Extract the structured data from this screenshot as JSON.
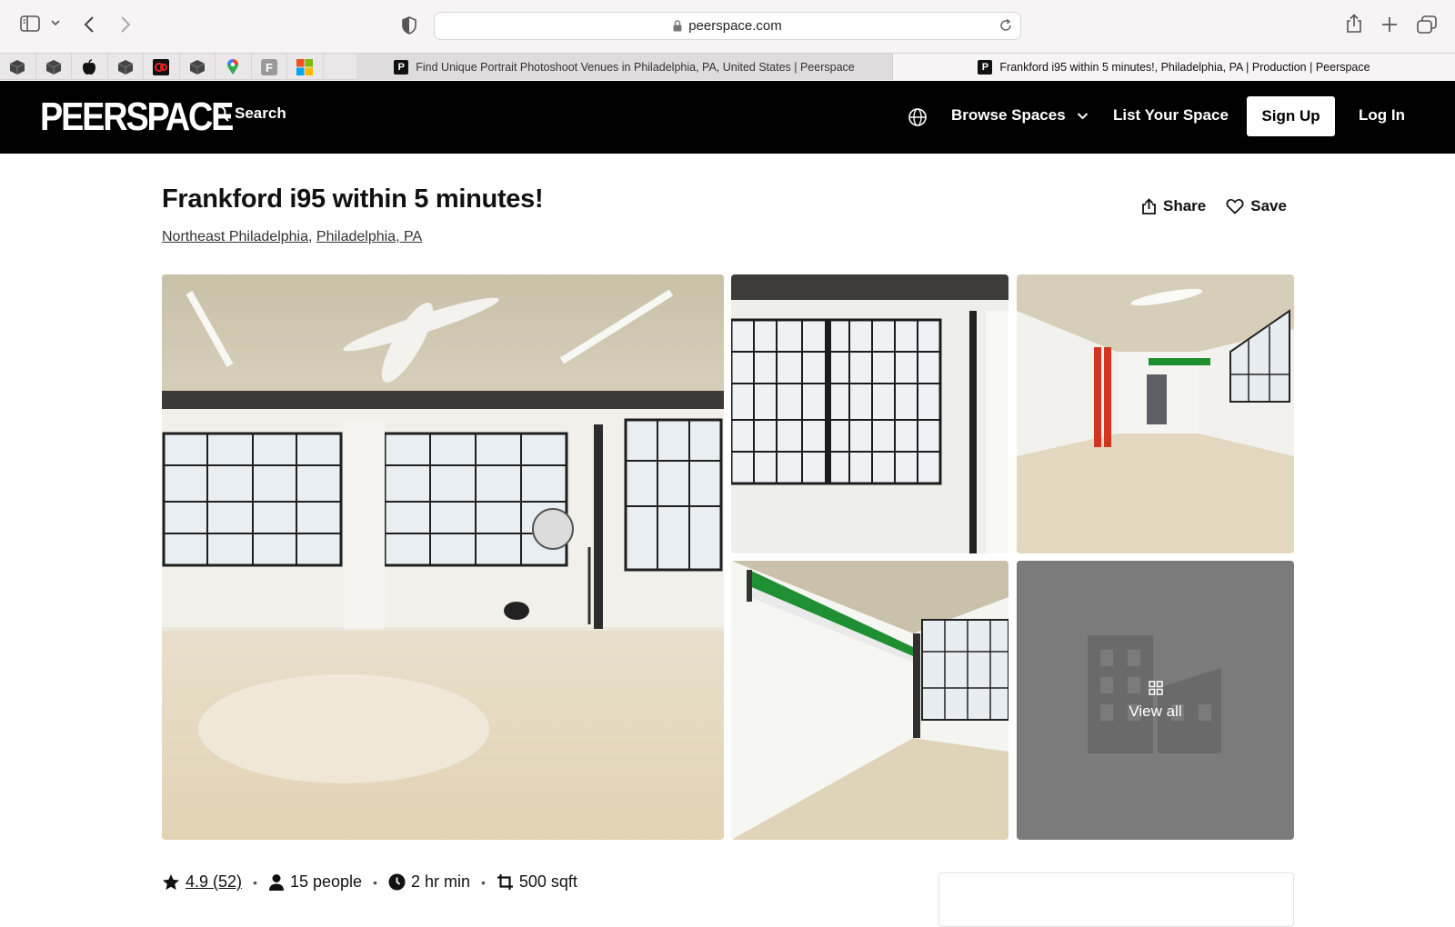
{
  "browser": {
    "url": "peerspace.com",
    "tabs": [
      {
        "title": "Find Unique Portrait Photoshoot Venues in Philadelphia, PA, United States | Peerspace",
        "active": false
      },
      {
        "title": "Frankford i95 within 5 minutes!, Philadelphia, PA | Production | Peerspace",
        "active": true
      }
    ],
    "favorites": [
      "box-icon",
      "box-icon",
      "apple-icon",
      "box-icon",
      "red-app-icon",
      "box-icon",
      "maps-icon",
      "f-letter-icon",
      "microsoft-icon"
    ]
  },
  "nav": {
    "logo": "PEERSPACE",
    "search": "Search",
    "browse": "Browse Spaces",
    "list_space": "List Your Space",
    "signup": "Sign Up",
    "login": "Log In"
  },
  "listing": {
    "title": "Frankford i95 within 5 minutes!",
    "neighborhood": "Northeast Philadelphia",
    "city": "Philadelphia, PA",
    "share": "Share",
    "save": "Save",
    "view_all": "View all",
    "rating": "4.9 (52)",
    "capacity": "15 people",
    "min_hours": "2 hr min",
    "size": "500 sqft"
  }
}
